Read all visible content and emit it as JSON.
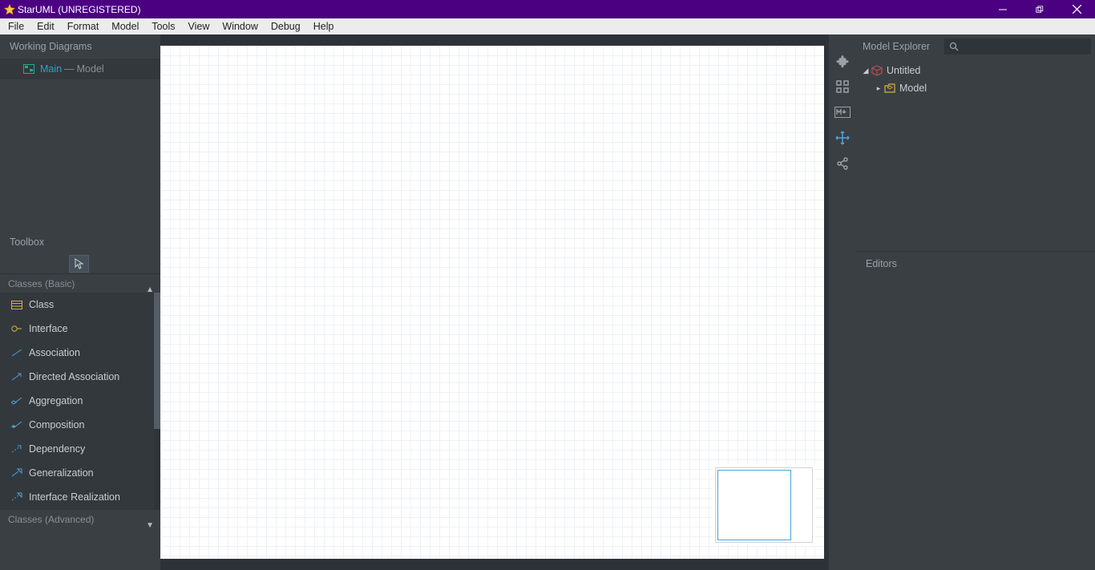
{
  "titlebar": {
    "title": "StarUML (UNREGISTERED)"
  },
  "menu": {
    "items": [
      "File",
      "Edit",
      "Format",
      "Model",
      "Tools",
      "View",
      "Window",
      "Debug",
      "Help"
    ]
  },
  "left": {
    "working_diagrams_title": "Working Diagrams",
    "wd_item_main": "Main",
    "wd_item_sep": " — ",
    "wd_item_model": "Model",
    "toolbox_title": "Toolbox",
    "section_basic": "Classes (Basic)",
    "section_advanced": "Classes (Advanced)",
    "tools": [
      "Class",
      "Interface",
      "Association",
      "Directed Association",
      "Aggregation",
      "Composition",
      "Dependency",
      "Generalization",
      "Interface Realization"
    ]
  },
  "right": {
    "model_explorer_title": "Model Explorer",
    "search_placeholder": "",
    "tree_root": "Untitled",
    "tree_child": "Model",
    "editors_title": "Editors"
  }
}
